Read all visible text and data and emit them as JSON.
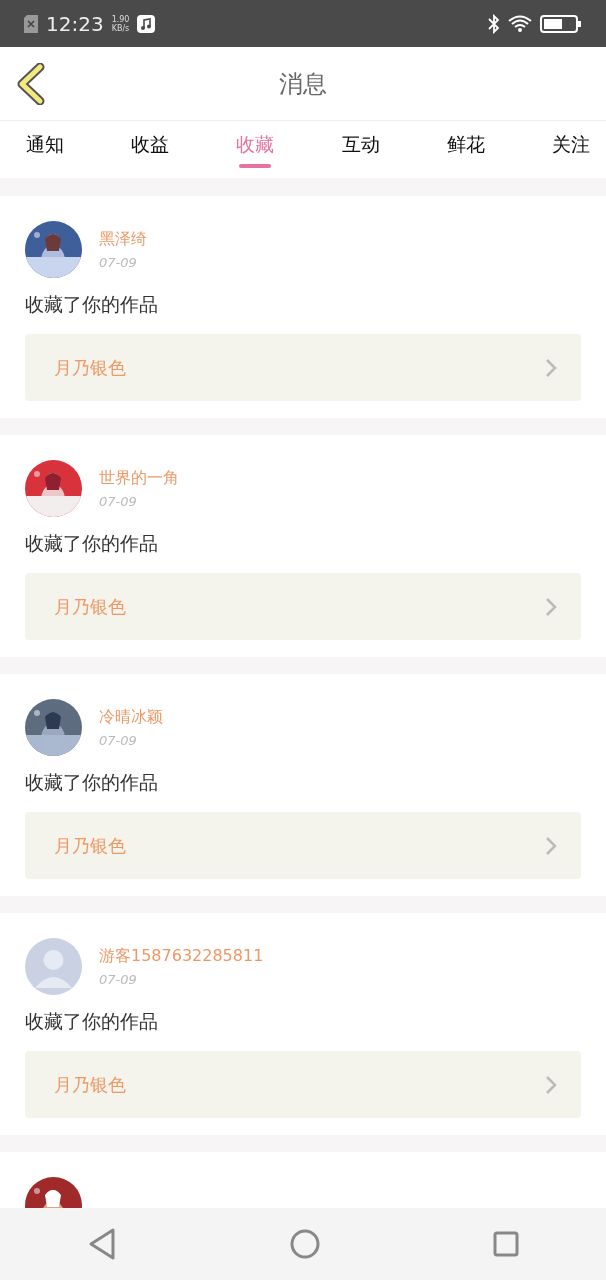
{
  "status_bar": {
    "time": "12:23",
    "speed_value": "1.90",
    "speed_unit": "KB/s"
  },
  "header": {
    "title": "消息"
  },
  "tabs": [
    {
      "label": "通知",
      "selected": false
    },
    {
      "label": "收益",
      "selected": false
    },
    {
      "label": "收藏",
      "selected": true
    },
    {
      "label": "互动",
      "selected": false
    },
    {
      "label": "鲜花",
      "selected": false
    },
    {
      "label": "关注",
      "selected": false
    }
  ],
  "messages": [
    {
      "avatar": {
        "kind": "picture"
      },
      "name": "黑泽绮",
      "date": "07-09",
      "text": "收藏了你的作品",
      "work": "月乃银色"
    },
    {
      "avatar": {
        "kind": "picture"
      },
      "name": "世界的一角",
      "date": "07-09",
      "text": "收藏了你的作品",
      "work": "月乃银色"
    },
    {
      "avatar": {
        "kind": "picture"
      },
      "name": "冷晴冰颖",
      "date": "07-09",
      "text": "收藏了你的作品",
      "work": "月乃银色"
    },
    {
      "avatar": {
        "kind": "default"
      },
      "name": "游客1587632285811",
      "date": "07-09",
      "text": "收藏了你的作品",
      "work": "月乃银色"
    },
    {
      "avatar": {
        "kind": "picture"
      }
    }
  ]
}
